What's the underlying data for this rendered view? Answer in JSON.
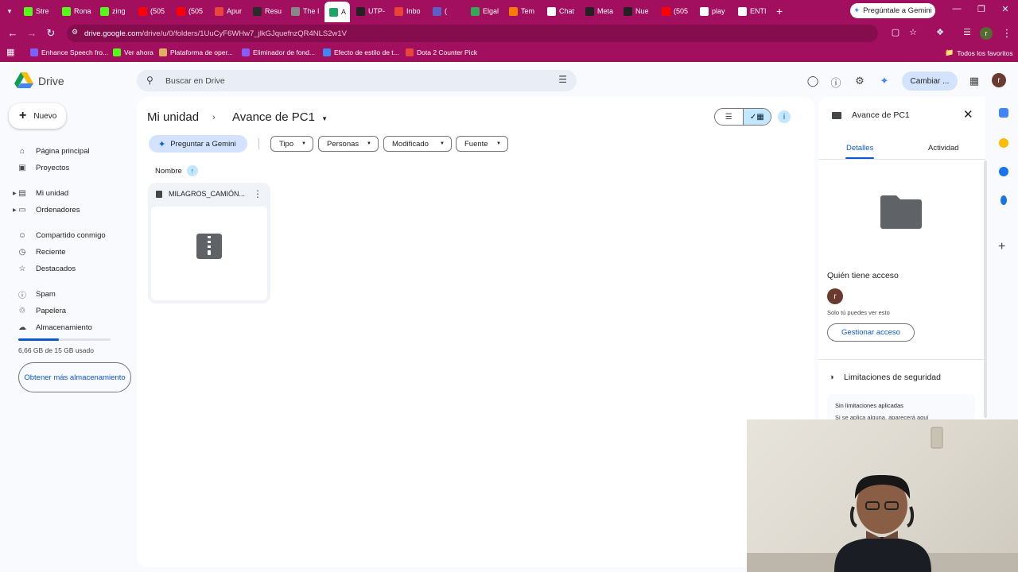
{
  "browser": {
    "tabs": [
      {
        "label": "Stre",
        "color": "#53fc18"
      },
      {
        "label": "Rona",
        "color": "#53fc18"
      },
      {
        "label": "zing",
        "color": "#53fc18"
      },
      {
        "label": "(505",
        "color": "#ff0000"
      },
      {
        "label": "(505",
        "color": "#ff0000"
      },
      {
        "label": "Apur",
        "color": "#e8453c"
      },
      {
        "label": "Resu",
        "color": "#2b2b2b"
      },
      {
        "label": "The I",
        "color": "#888888"
      },
      {
        "label": "A",
        "color": "#1fa463",
        "active": true
      },
      {
        "label": "UTP-",
        "color": "#222222"
      },
      {
        "label": "Inbo",
        "color": "#ea4335"
      },
      {
        "label": "(",
        "color": "#5b5fc7"
      },
      {
        "label": "Elgal",
        "color": "#34a853"
      },
      {
        "label": "Tem",
        "color": "#f57c00"
      },
      {
        "label": "Chat",
        "color": "#ffffff"
      },
      {
        "label": "Meta",
        "color": "#222222"
      },
      {
        "label": "Nue",
        "color": "#222222"
      },
      {
        "label": "(505",
        "color": "#ff0000"
      },
      {
        "label": "play",
        "color": "#ffffff"
      },
      {
        "label": "ENTI",
        "color": "#ffffff"
      }
    ],
    "gemini_button": "Pregúntale a Gemini",
    "url_host": "drive.google.com",
    "url_path": "/drive/u/0/folders/1UuCyF6WHw7_jlkGJquefnzQR4NLS2w1V",
    "bookmarks": [
      {
        "label": "Enhance Speech fro...",
        "color": "#7b61ff"
      },
      {
        "label": "Ver ahora",
        "color": "#53fc18"
      },
      {
        "label": "Plataforma de oper...",
        "color": "#e0b060"
      },
      {
        "label": "Eliminador de fond...",
        "color": "#8a5cf6"
      },
      {
        "label": "Efecto de estilo de t...",
        "color": "#4285f4"
      },
      {
        "label": "Dota 2 Counter Pick",
        "color": "#e8453c"
      }
    ],
    "all_bookmarks": "Todos los favoritos"
  },
  "drive": {
    "app_name": "Drive",
    "search_placeholder": "Buscar en Drive",
    "switch_button": "Cambiar ...",
    "avatar_letter": "r",
    "new_button": "Nuevo",
    "nav": [
      {
        "label": "Página principal",
        "icon": "home-icon"
      },
      {
        "label": "Proyectos",
        "icon": "projects-icon"
      },
      {
        "label": "Mi unidad",
        "icon": "my-drive-icon"
      },
      {
        "label": "Ordenadores",
        "icon": "computers-icon"
      },
      {
        "label": "Compartido conmigo",
        "icon": "shared-icon"
      },
      {
        "label": "Reciente",
        "icon": "clock-icon"
      },
      {
        "label": "Destacados",
        "icon": "star-icon"
      },
      {
        "label": "Spam",
        "icon": "spam-icon"
      },
      {
        "label": "Papelera",
        "icon": "trash-icon"
      },
      {
        "label": "Almacenamiento",
        "icon": "cloud-icon"
      }
    ],
    "storage_used_fraction": 0.44,
    "storage_text": "6,66 GB de 15 GB usado",
    "more_storage": "Obtener más almacenamiento",
    "breadcrumb_root": "Mi unidad",
    "breadcrumb_current": "Avance de PC1",
    "ask_gemini": "Preguntar a Gemini",
    "filters": [
      "Tipo",
      "Personas",
      "Modificado",
      "Fuente"
    ],
    "sort_label": "Nombre",
    "file_name": "MILAGROS_CAMIÓN...",
    "details": {
      "title": "Avance de PC1",
      "tab_details": "Detalles",
      "tab_activity": "Actividad",
      "access_heading": "Quién tiene acceso",
      "access_text": "Solo tú puedes ver esto",
      "manage_button": "Gestionar acceso",
      "security_heading": "Limitaciones de seguridad",
      "security_text1": "Sin limitaciones aplicadas",
      "security_text2": "Si se aplica alguna, aparecerá aquí"
    },
    "accent": "#0b57d0",
    "chrome_color": "#a30f5f"
  }
}
